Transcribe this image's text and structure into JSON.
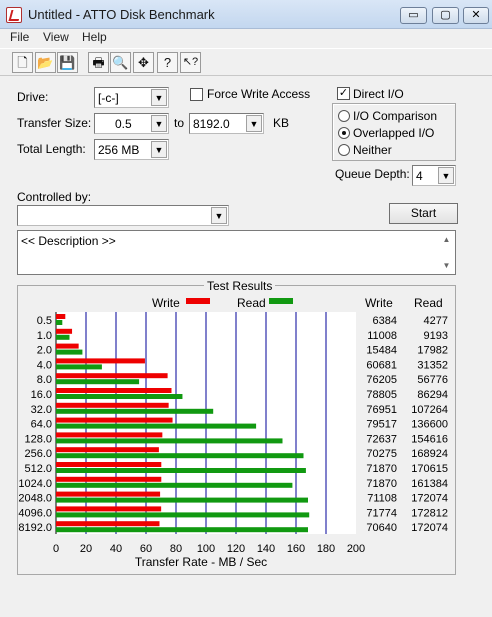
{
  "window": {
    "title": "Untitled - ATTO Disk Benchmark",
    "minimize_glyph": "▭",
    "maximize_glyph": "▢",
    "close_glyph": "✕"
  },
  "menu": [
    "File",
    "View",
    "Help"
  ],
  "toolbar": {
    "icons": [
      "new-icon",
      "open-icon",
      "save-icon",
      "print-icon",
      "print-preview-icon",
      "move-icon",
      "help-icon",
      "context-help-icon"
    ],
    "glyphs": [
      "🗋",
      "📂",
      "💾",
      "🖶",
      "🔍",
      "✥",
      "?",
      "↖?"
    ]
  },
  "settings": {
    "drive_label": "Drive:",
    "drive_value": "[-c-]",
    "transfer_size_label": "Transfer Size:",
    "transfer_from": "0.5",
    "to_label": "to",
    "transfer_to": "8192.0",
    "kb_label": "KB",
    "total_length_label": "Total Length:",
    "total_length_value": "256 MB",
    "force_write_label": "Force Write Access",
    "force_write_checked": false,
    "direct_io_label": "Direct I/O",
    "direct_io_checked": true,
    "io_comparison_label": "I/O Comparison",
    "overlapped_io_label": "Overlapped I/O",
    "neither_label": "Neither",
    "selected_io_mode": "Overlapped I/O",
    "queue_depth_label": "Queue Depth:",
    "queue_depth_value": "4",
    "controlled_by_label": "Controlled by:",
    "controlled_by_value": "",
    "start_label": "Start",
    "description_text": "<< Description >>"
  },
  "results": {
    "group_title": "Test Results",
    "legend_write": "Write",
    "legend_read": "Read",
    "col_write": "Write",
    "col_read": "Read",
    "colors": {
      "write": "#ee0000",
      "read": "#119911",
      "grid": "#000099"
    },
    "xlabel": "Transfer Rate - MB / Sec",
    "x_ticks": [
      "0",
      "20",
      "40",
      "60",
      "80",
      "100",
      "120",
      "140",
      "160",
      "180",
      "200"
    ],
    "rows": [
      {
        "size": "0.5",
        "write": "6384",
        "read": "4277"
      },
      {
        "size": "1.0",
        "write": "11008",
        "read": "9193"
      },
      {
        "size": "2.0",
        "write": "15484",
        "read": "17982"
      },
      {
        "size": "4.0",
        "write": "60681",
        "read": "31352"
      },
      {
        "size": "8.0",
        "write": "76205",
        "read": "56776"
      },
      {
        "size": "16.0",
        "write": "78805",
        "read": "86294"
      },
      {
        "size": "32.0",
        "write": "76951",
        "read": "107264"
      },
      {
        "size": "64.0",
        "write": "79517",
        "read": "136600"
      },
      {
        "size": "128.0",
        "write": "72637",
        "read": "154616"
      },
      {
        "size": "256.0",
        "write": "70275",
        "read": "168924"
      },
      {
        "size": "512.0",
        "write": "71870",
        "read": "170615"
      },
      {
        "size": "1024.0",
        "write": "71870",
        "read": "161384"
      },
      {
        "size": "2048.0",
        "write": "71108",
        "read": "172074"
      },
      {
        "size": "4096.0",
        "write": "71774",
        "read": "172812"
      },
      {
        "size": "8192.0",
        "write": "70640",
        "read": "172074"
      }
    ]
  },
  "chart_data": {
    "type": "bar",
    "orientation": "horizontal",
    "categories": [
      "0.5",
      "1.0",
      "2.0",
      "4.0",
      "8.0",
      "16.0",
      "32.0",
      "64.0",
      "128.0",
      "256.0",
      "512.0",
      "1024.0",
      "2048.0",
      "4096.0",
      "8192.0"
    ],
    "series": [
      {
        "name": "Write",
        "values": [
          6.2,
          10.7,
          15.1,
          59.3,
          74.4,
          77.0,
          75.1,
          77.7,
          70.9,
          68.6,
          70.2,
          70.2,
          69.4,
          70.1,
          69.0
        ]
      },
      {
        "name": "Read",
        "values": [
          4.2,
          9.0,
          17.6,
          30.6,
          55.4,
          84.3,
          104.8,
          133.4,
          151.0,
          165.0,
          166.6,
          157.6,
          168.0,
          168.8,
          168.0
        ]
      }
    ],
    "title": "Test Results",
    "xlabel": "Transfer Rate - MB / Sec",
    "ylabel": "",
    "xlim": [
      0,
      200
    ],
    "grid": true,
    "legend": "top"
  }
}
